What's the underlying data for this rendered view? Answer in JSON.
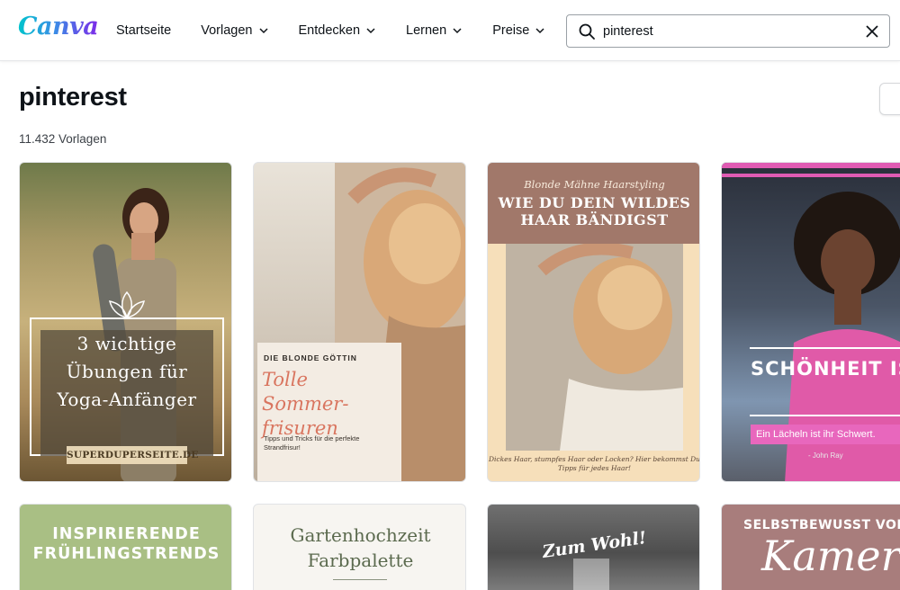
{
  "brand": {
    "logo_text": "Canva",
    "colors": {
      "gradient_start": "#00c4cc",
      "gradient_end": "#7d2ae8"
    }
  },
  "nav": {
    "items": [
      {
        "label": "Startseite",
        "has_dropdown": false
      },
      {
        "label": "Vorlagen",
        "has_dropdown": true
      },
      {
        "label": "Entdecken",
        "has_dropdown": true
      },
      {
        "label": "Lernen",
        "has_dropdown": true
      },
      {
        "label": "Preise",
        "has_dropdown": true
      }
    ]
  },
  "search": {
    "value": "pinterest",
    "icon": "search-icon",
    "clear_icon": "close-icon"
  },
  "results": {
    "title": "pinterest",
    "count": "11.432 Vorlagen"
  },
  "templates": [
    {
      "title": "3 wichtige Übungen für Yoga-Anfänger",
      "footer": "SUPERDUPERSEITE.DE"
    },
    {
      "kicker": "DIE BLONDE GÖTTIN",
      "title": "Tolle Sommer-frisuren",
      "subtitle": "Tipps und Tricks für die perfekte Strandfrisur!"
    },
    {
      "kicker": "Blonde Mähne Haarstyling",
      "title": "WIE DU DEIN WILDES HAAR BÄNDIGST",
      "footer": "Dickes Haar, stumpfes Haar oder Locken? Hier bekommst Du Tipps für jedes Haar!"
    },
    {
      "title": "SCHÖNHEIT IST MACHT",
      "subtitle": "Ein Lächeln ist ihr Schwert.",
      "author": "- John Ray"
    },
    {
      "title": "INSPIRIERENDE FRÜHLINGSTRENDS"
    },
    {
      "title": "Gartenhochzeit Farbpalette"
    },
    {
      "title": "Zum Wohl!"
    },
    {
      "kicker": "SELBSTBEWUSST VOR D",
      "title": "Kamera"
    }
  ]
}
